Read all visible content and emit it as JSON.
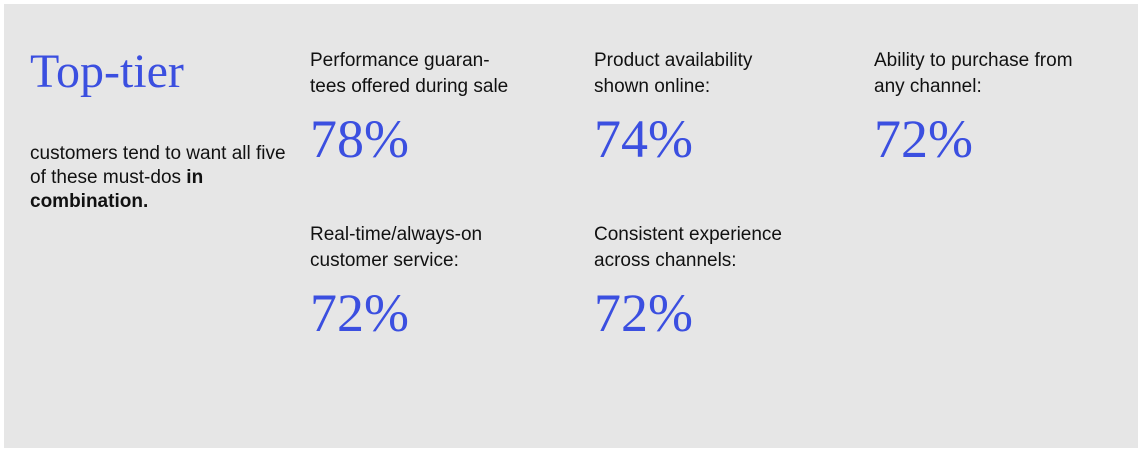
{
  "title": "Top-tier",
  "description": {
    "text": "customers tend to want all five of these must-dos ",
    "emphasis": "in combination."
  },
  "stats": [
    {
      "label": "Performance guaran-\ntees offered during sale",
      "value": "78%"
    },
    {
      "label": "Product availability\nshown online:",
      "value": "74%"
    },
    {
      "label": "Ability to purchase from\nany channel:",
      "value": "72%"
    },
    {
      "label": "Real-time/always-on\ncustomer service:",
      "value": "72%"
    },
    {
      "label": "Consistent experience\nacross channels:",
      "value": "72%"
    }
  ],
  "colors": {
    "accent": "#3b4fe0",
    "background": "#e6e6e6",
    "text": "#111111"
  }
}
